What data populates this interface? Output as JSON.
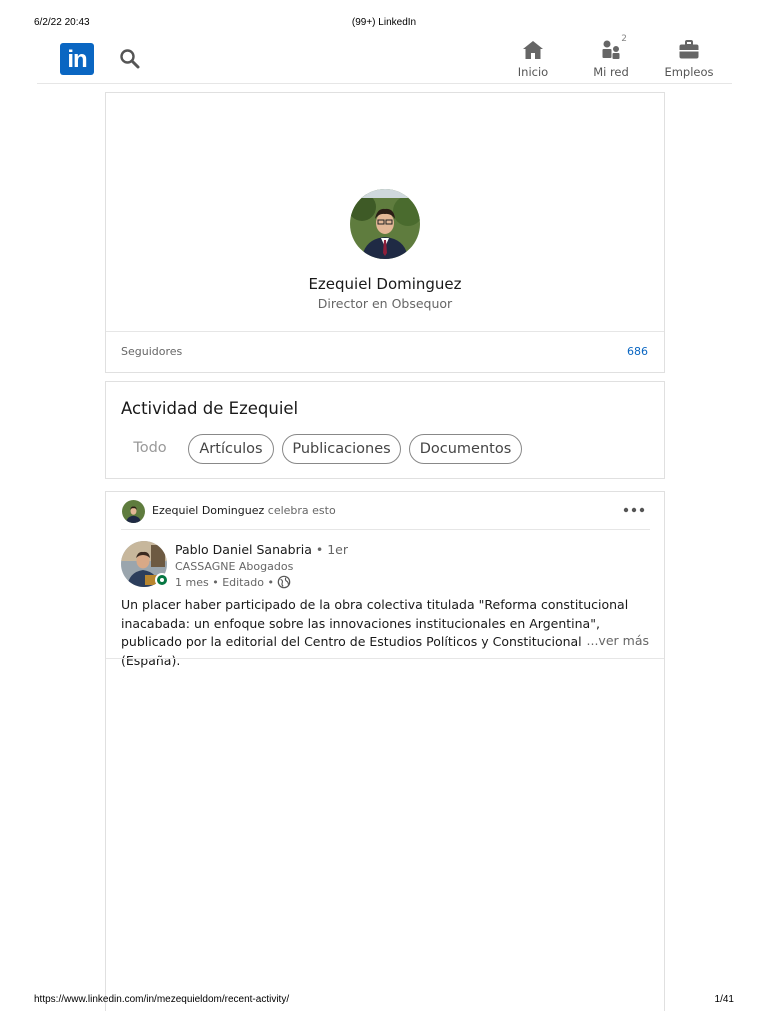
{
  "print": {
    "timestamp": "6/2/22 20:43",
    "title": "(99+) LinkedIn",
    "url": "https://www.linkedin.com/in/mezequieldom/recent-activity/",
    "page": "1/41"
  },
  "nav": {
    "logo": "in",
    "home_label": "Inicio",
    "network_label": "Mi red",
    "network_badge": "2",
    "jobs_label": "Empleos"
  },
  "profile": {
    "name": "Ezequiel Dominguez",
    "headline": "Director en Obsequor",
    "followers_label": "Seguidores",
    "followers_count": "686"
  },
  "activity": {
    "title": "Actividad de Ezequiel",
    "filters": [
      "Todo",
      "Artículos",
      "Publicaciones",
      "Documentos"
    ]
  },
  "feed": {
    "actor_name": "Ezequiel Dominguez",
    "actor_action": "celebra esto",
    "post": {
      "author": "Pablo Daniel Sanabria",
      "degree": "• 1er",
      "subtitle": "CASSAGNE Abogados",
      "meta": "1 mes • Editado •",
      "text": "Un placer haber participado de la obra colectiva titulada \"Reforma constitucional inacabada: un enfoque sobre las innovaciones institucionales en Argentina\", publicado por la editorial del Centro de Estudios Políticos y Constitucionales (España).",
      "see_more": "...ver más"
    }
  },
  "colors": {
    "brand": "#0a66c2",
    "online": "#057642"
  }
}
